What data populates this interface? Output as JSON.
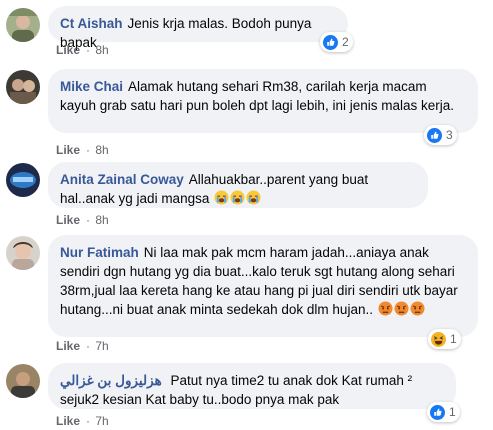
{
  "comments": [
    {
      "author": "Ct Aishah",
      "text": "Jenis krja malas. Bodoh punya bapak",
      "like_label": "Like",
      "time": "8h",
      "reaction": {
        "type": "like",
        "count": "2"
      }
    },
    {
      "author": "Mike Chai",
      "text": "Alamak hutang sehari Rm38, carilah kerja macam kayuh grab satu hari pun boleh dpt lagi lebih, ini jenis malas kerja.",
      "like_label": "Like",
      "time": "8h",
      "reaction": {
        "type": "like",
        "count": "3"
      }
    },
    {
      "author": "Anita Zainal Coway",
      "text": "Allahuakbar..parent yang buat hal..anak yg jadi mangsa",
      "emojis": [
        "crying-face",
        "crying-face",
        "crying-face"
      ],
      "like_label": "Like",
      "time": "8h"
    },
    {
      "author": "Nur Fatimah",
      "text": "Ni laa mak pak mcm haram jadah...aniaya anak sendiri dgn hutang yg dia buat...kalo teruk sgt hutang along sehari 38rm,jual laa kereta hang ke atau hang pi jual diri sendiri utk bayar hutang...ni buat anak minta sedekah dok dlm hujan..",
      "emojis": [
        "angry-face",
        "angry-face",
        "angry-face"
      ],
      "like_label": "Like",
      "time": "7h",
      "reaction": {
        "type": "haha",
        "count": "1"
      }
    },
    {
      "author": "هزليزول بن غزالي",
      "text": "Patut nya time2 tu anak dok Kat rumah ² sejuk2 kesian Kat baby tu..bodo pnya mak pak",
      "like_label": "Like",
      "time": "7h",
      "reaction": {
        "type": "like",
        "count": "1"
      }
    }
  ],
  "colors": {
    "author": "#385898",
    "bubble": "#f0f2f5",
    "meta": "#65676b",
    "like_blue": "#1877f2",
    "haha_yellow": "#f7b125"
  }
}
